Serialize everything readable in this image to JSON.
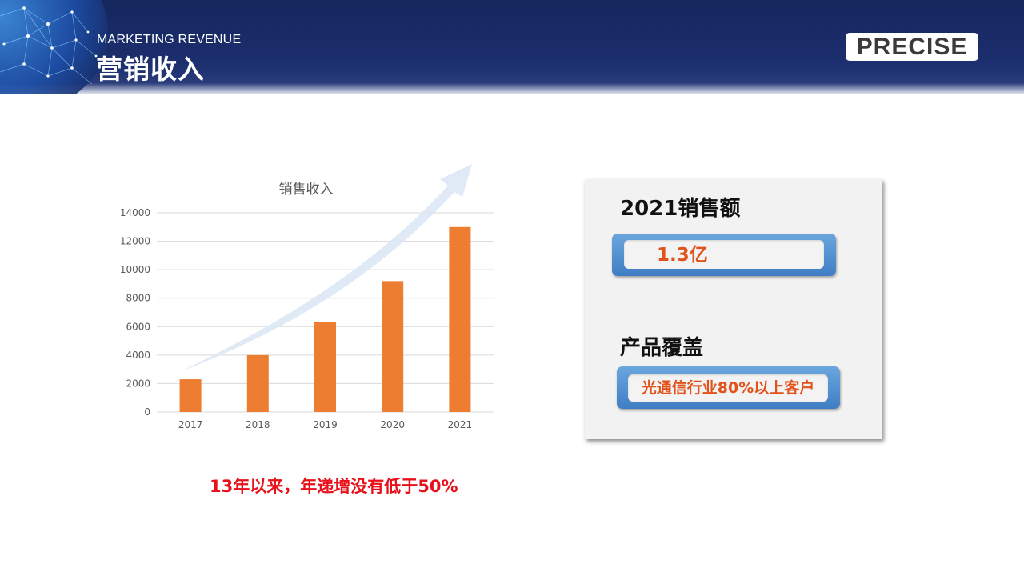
{
  "header": {
    "subtitle": "MARKETING REVENUE",
    "title": "营销收入",
    "logo_text": "PRECISE"
  },
  "chart_data": {
    "type": "bar",
    "title": "销售收入",
    "categories": [
      "2017",
      "2018",
      "2019",
      "2020",
      "2021"
    ],
    "values": [
      2300,
      4000,
      6300,
      9200,
      13000
    ],
    "yticks": [
      0,
      2000,
      4000,
      6000,
      8000,
      10000,
      12000,
      14000
    ],
    "ylim": [
      0,
      14000
    ],
    "grid": true,
    "bar_color": "#ed7d31",
    "arrow_color": "#dce8f5"
  },
  "footnote": "13年以来，年递增没有低于50%",
  "panel": {
    "sales_heading": "2021销售额",
    "sales_value": "1.3亿",
    "coverage_heading": "产品覆盖",
    "coverage_value": "光通信行业80%以上客户"
  }
}
